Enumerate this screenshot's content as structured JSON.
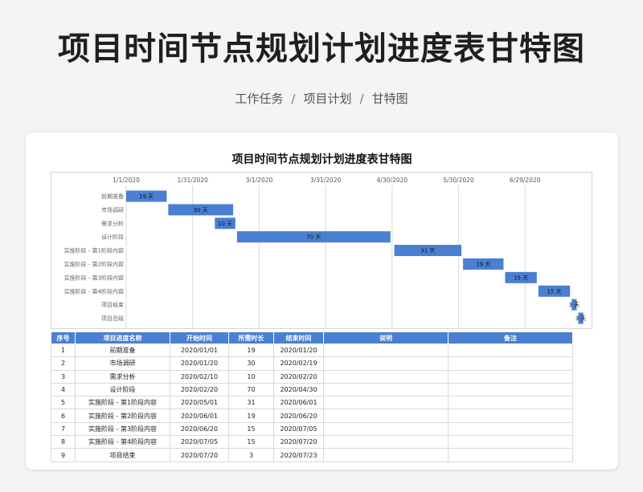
{
  "page": {
    "title": "项目时间节点规划计划进度表甘特图",
    "breadcrumb": [
      "工作任务",
      "项目计划",
      "甘特图"
    ],
    "breadcrumb_separator": "/"
  },
  "sheet": {
    "title": "项目时间节点规划计划进度表甘特图"
  },
  "colors": {
    "bar": "#4a7fd1",
    "header": "#4a7fd1",
    "grid": "#d9d9d9"
  },
  "chart_data": {
    "type": "bar",
    "orientation": "horizontal-gantt",
    "x_ticks": [
      "1/1/2020",
      "1/31/2020",
      "3/1/2020",
      "3/31/2020",
      "4/30/2020",
      "5/30/2020",
      "6/29/2020"
    ],
    "x_range": [
      "2020-01-01",
      "2020-07-29"
    ],
    "grid": true,
    "tasks": [
      {
        "name": "前期准备",
        "start": "2020-01-01",
        "days": 19,
        "label": "19 天"
      },
      {
        "name": "市场调研",
        "start": "2020-01-20",
        "days": 30,
        "label": "30 天"
      },
      {
        "name": "需求分析",
        "start": "2020-02-10",
        "days": 10,
        "label": "10 天"
      },
      {
        "name": "设计阶段",
        "start": "2020-02-20",
        "days": 70,
        "label": "70 天"
      },
      {
        "name": "实施阶段 - 第1阶段内容",
        "start": "2020-05-01",
        "days": 31,
        "label": "31 天"
      },
      {
        "name": "实施阶段 - 第2阶段内容",
        "start": "2020-06-01",
        "days": 19,
        "label": "19 天"
      },
      {
        "name": "实施阶段 - 第3阶段内容",
        "start": "2020-06-20",
        "days": 15,
        "label": "15 天"
      },
      {
        "name": "实施阶段 - 第4阶段内容",
        "start": "2020-07-05",
        "days": 15,
        "label": "15 天"
      },
      {
        "name": "项目结束",
        "start": "2020-07-20",
        "days": 3,
        "label": "3 天"
      },
      {
        "name": "项目总结",
        "start": "2020-07-23",
        "days": 3,
        "label": "3 天"
      }
    ]
  },
  "table": {
    "headers": [
      "序号",
      "项目进度名称",
      "开始时间",
      "所需时长",
      "结束时间",
      "说明",
      "备注"
    ],
    "rows": [
      [
        "1",
        "前期准备",
        "2020/01/01",
        "19",
        "2020/01/20",
        "",
        ""
      ],
      [
        "2",
        "市场调研",
        "2020/01/20",
        "30",
        "2020/02/19",
        "",
        ""
      ],
      [
        "3",
        "需求分析",
        "2020/02/10",
        "10",
        "2020/02/20",
        "",
        ""
      ],
      [
        "4",
        "设计阶段",
        "2020/02/20",
        "70",
        "2020/04/30",
        "",
        ""
      ],
      [
        "5",
        "实施阶段 - 第1阶段内容",
        "2020/05/01",
        "31",
        "2020/06/01",
        "",
        ""
      ],
      [
        "6",
        "实施阶段 - 第2阶段内容",
        "2020/06/01",
        "19",
        "2020/06/20",
        "",
        ""
      ],
      [
        "7",
        "实施阶段 - 第3阶段内容",
        "2020/06/20",
        "15",
        "2020/07/05",
        "",
        ""
      ],
      [
        "8",
        "实施阶段 - 第4阶段内容",
        "2020/07/05",
        "15",
        "2020/07/20",
        "",
        ""
      ],
      [
        "9",
        "项目结束",
        "2020/07/20",
        "3",
        "2020/07/23",
        "",
        ""
      ]
    ]
  }
}
